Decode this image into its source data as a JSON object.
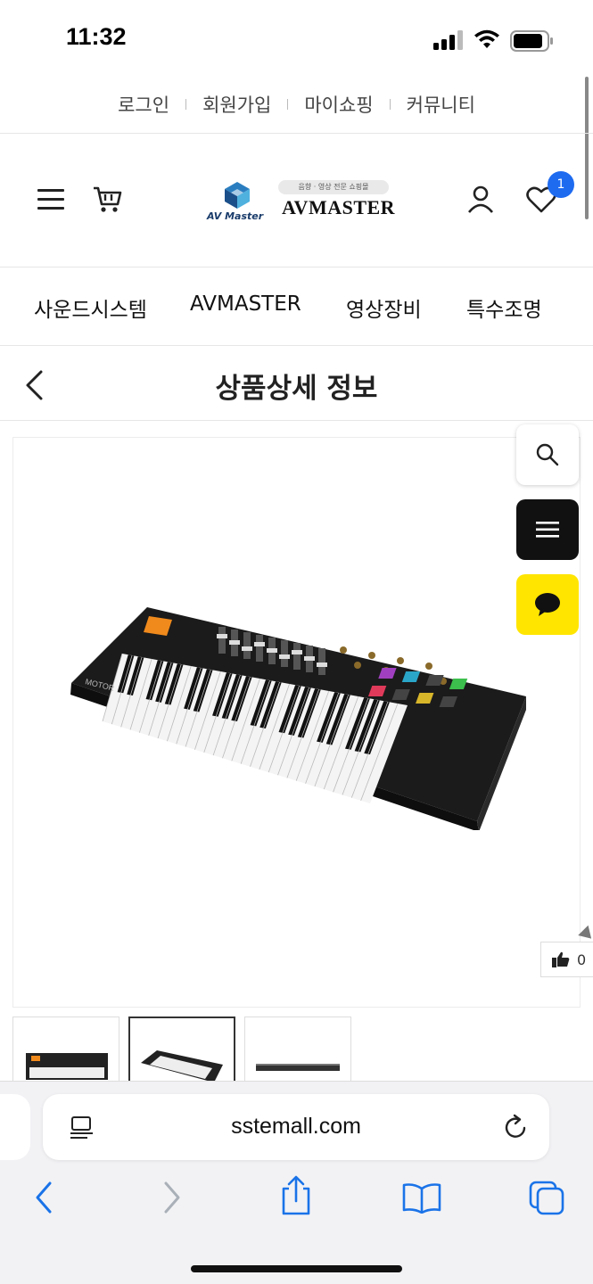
{
  "status_bar": {
    "time": "11:32"
  },
  "top_links": [
    {
      "label": "로그인"
    },
    {
      "label": "회원가입"
    },
    {
      "label": "마이쇼핑"
    },
    {
      "label": "커뮤니티"
    }
  ],
  "header": {
    "logo_small_text": "AV Master",
    "logo_tagline": "음향 · 영상 전문 쇼핑몰",
    "logo_text": "AVMASTER",
    "wishlist_count": "1",
    "accent_color": "#1e6bf0"
  },
  "categories": [
    {
      "label": "사운드시스템"
    },
    {
      "label": "AVMASTER"
    },
    {
      "label": "영상장비"
    },
    {
      "label": "특수조명"
    }
  ],
  "page": {
    "title": "상품상세 정보"
  },
  "product": {
    "brand_on_device": "MOTOR"
  },
  "like": {
    "count": "0"
  },
  "browser": {
    "url": "sstemall.com"
  },
  "icons": {
    "search": "search-icon",
    "menu": "menu-icon",
    "chat": "chat-bubble-icon",
    "like": "thumbs-up-icon"
  },
  "colors": {
    "chat_button": "#ffe500",
    "menu_button": "#111111",
    "ios_link": "#1a73e8"
  }
}
